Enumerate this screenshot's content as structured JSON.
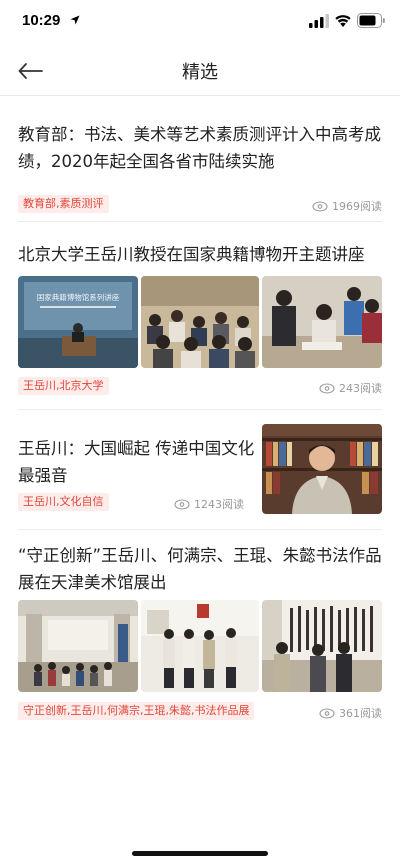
{
  "status": {
    "time": "10:29"
  },
  "nav": {
    "title": "精选"
  },
  "articles": [
    {
      "title": "教育部：书法、美术等艺术素质测评计入中高考成绩，2020年起全国各省市陆续实施",
      "tag": "教育部,素质测评",
      "reads": "1969阅读"
    },
    {
      "title": "北京大学王岳川教授在国家典籍博物开主题讲座",
      "tag": "王岳川,北京大学",
      "reads": "243阅读",
      "banner_text": "国家典籍博物馆系列讲座"
    },
    {
      "title": "王岳川：大国崛起 传递中国文化最强音",
      "tag": "王岳川,文化自信",
      "reads": "1243阅读"
    },
    {
      "title": "“守正创新”王岳川、何满宗、王琨、朱懿书法作品展在天津美术馆展出",
      "tag": "守正创新,王岳川,何满宗,王琨,朱懿,书法作品展",
      "reads": "361阅读"
    }
  ],
  "icons": {
    "back": "back-arrow-icon",
    "location": "location-arrow-icon",
    "signal": "cellular-signal-icon",
    "wifi": "wifi-icon",
    "battery": "battery-icon",
    "reads": "eye-icon"
  },
  "colors": {
    "tag_bg": "#fdecea",
    "tag_text": "#e2473a",
    "meta_text": "#999999"
  }
}
